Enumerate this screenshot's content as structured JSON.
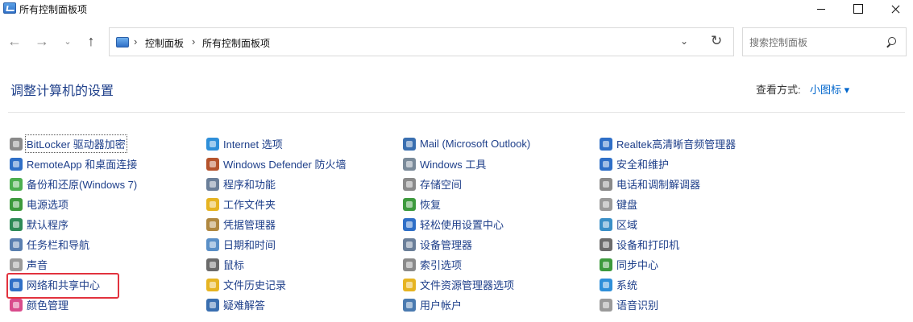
{
  "window": {
    "title": "所有控制面板项"
  },
  "nav": {
    "breadcrumb": [
      "控制面板",
      "所有控制面板项"
    ],
    "search_placeholder": "搜索控制面板"
  },
  "header": {
    "title": "调整计算机的设置",
    "view_label": "查看方式:",
    "view_value": "小图标 ▾"
  },
  "columns": [
    [
      {
        "label": "BitLocker 驱动器加密",
        "icon": "bitlocker-icon",
        "color": "#8a8a8a"
      },
      {
        "label": "RemoteApp 和桌面连接",
        "icon": "remoteapp-icon",
        "color": "#2f6fc7"
      },
      {
        "label": "备份和还原(Windows 7)",
        "icon": "backup-icon",
        "color": "#4caf50"
      },
      {
        "label": "电源选项",
        "icon": "power-icon",
        "color": "#3d9a3d"
      },
      {
        "label": "默认程序",
        "icon": "default-programs-icon",
        "color": "#2e8b57"
      },
      {
        "label": "任务栏和导航",
        "icon": "taskbar-icon",
        "color": "#5a7fb0"
      },
      {
        "label": "声音",
        "icon": "sound-icon",
        "color": "#9a9a9a"
      },
      {
        "label": "网络和共享中心",
        "icon": "network-icon",
        "color": "#2f6fc7"
      },
      {
        "label": "颜色管理",
        "icon": "color-management-icon",
        "color": "#d94b8c"
      }
    ],
    [
      {
        "label": "Internet 选项",
        "icon": "internet-options-icon",
        "color": "#2f8fd9"
      },
      {
        "label": "Windows Defender 防火墙",
        "icon": "firewall-icon",
        "color": "#b5532c"
      },
      {
        "label": "程序和功能",
        "icon": "programs-icon",
        "color": "#6b7f99"
      },
      {
        "label": "工作文件夹",
        "icon": "work-folders-icon",
        "color": "#e6b422"
      },
      {
        "label": "凭据管理器",
        "icon": "credential-icon",
        "color": "#b08840"
      },
      {
        "label": "日期和时间",
        "icon": "datetime-icon",
        "color": "#5a8fc7"
      },
      {
        "label": "鼠标",
        "icon": "mouse-icon",
        "color": "#6b6b6b"
      },
      {
        "label": "文件历史记录",
        "icon": "file-history-icon",
        "color": "#e6b422"
      },
      {
        "label": "疑难解答",
        "icon": "troubleshoot-icon",
        "color": "#3a6fb0"
      }
    ],
    [
      {
        "label": "Mail (Microsoft Outlook)",
        "icon": "mail-icon",
        "color": "#3a6fb0"
      },
      {
        "label": "Windows 工具",
        "icon": "windows-tools-icon",
        "color": "#7a8a99"
      },
      {
        "label": "存储空间",
        "icon": "storage-icon",
        "color": "#8a8a8a"
      },
      {
        "label": "恢复",
        "icon": "recovery-icon",
        "color": "#3d9a3d"
      },
      {
        "label": "轻松使用设置中心",
        "icon": "ease-of-access-icon",
        "color": "#2f6fc7"
      },
      {
        "label": "设备管理器",
        "icon": "device-manager-icon",
        "color": "#6b7f99"
      },
      {
        "label": "索引选项",
        "icon": "indexing-icon",
        "color": "#8a8a8a"
      },
      {
        "label": "文件资源管理器选项",
        "icon": "explorer-options-icon",
        "color": "#e6b422"
      },
      {
        "label": "用户帐户",
        "icon": "user-accounts-icon",
        "color": "#4a7ab0"
      }
    ],
    [
      {
        "label": "Realtek高清晰音频管理器",
        "icon": "realtek-icon",
        "color": "#2f6fc7"
      },
      {
        "label": "安全和维护",
        "icon": "security-icon",
        "color": "#2f6fc7"
      },
      {
        "label": "电话和调制解调器",
        "icon": "phone-modem-icon",
        "color": "#8a8a8a"
      },
      {
        "label": "键盘",
        "icon": "keyboard-icon",
        "color": "#9a9a9a"
      },
      {
        "label": "区域",
        "icon": "region-icon",
        "color": "#3a8fc7"
      },
      {
        "label": "设备和打印机",
        "icon": "printer-icon",
        "color": "#6b6b6b"
      },
      {
        "label": "同步中心",
        "icon": "sync-icon",
        "color": "#3d9a3d"
      },
      {
        "label": "系统",
        "icon": "system-icon",
        "color": "#2f8fd9"
      },
      {
        "label": "语音识别",
        "icon": "speech-icon",
        "color": "#9a9a9a"
      }
    ]
  ],
  "highlight": {
    "color": "#e2323e",
    "target": "网络和共享中心"
  }
}
